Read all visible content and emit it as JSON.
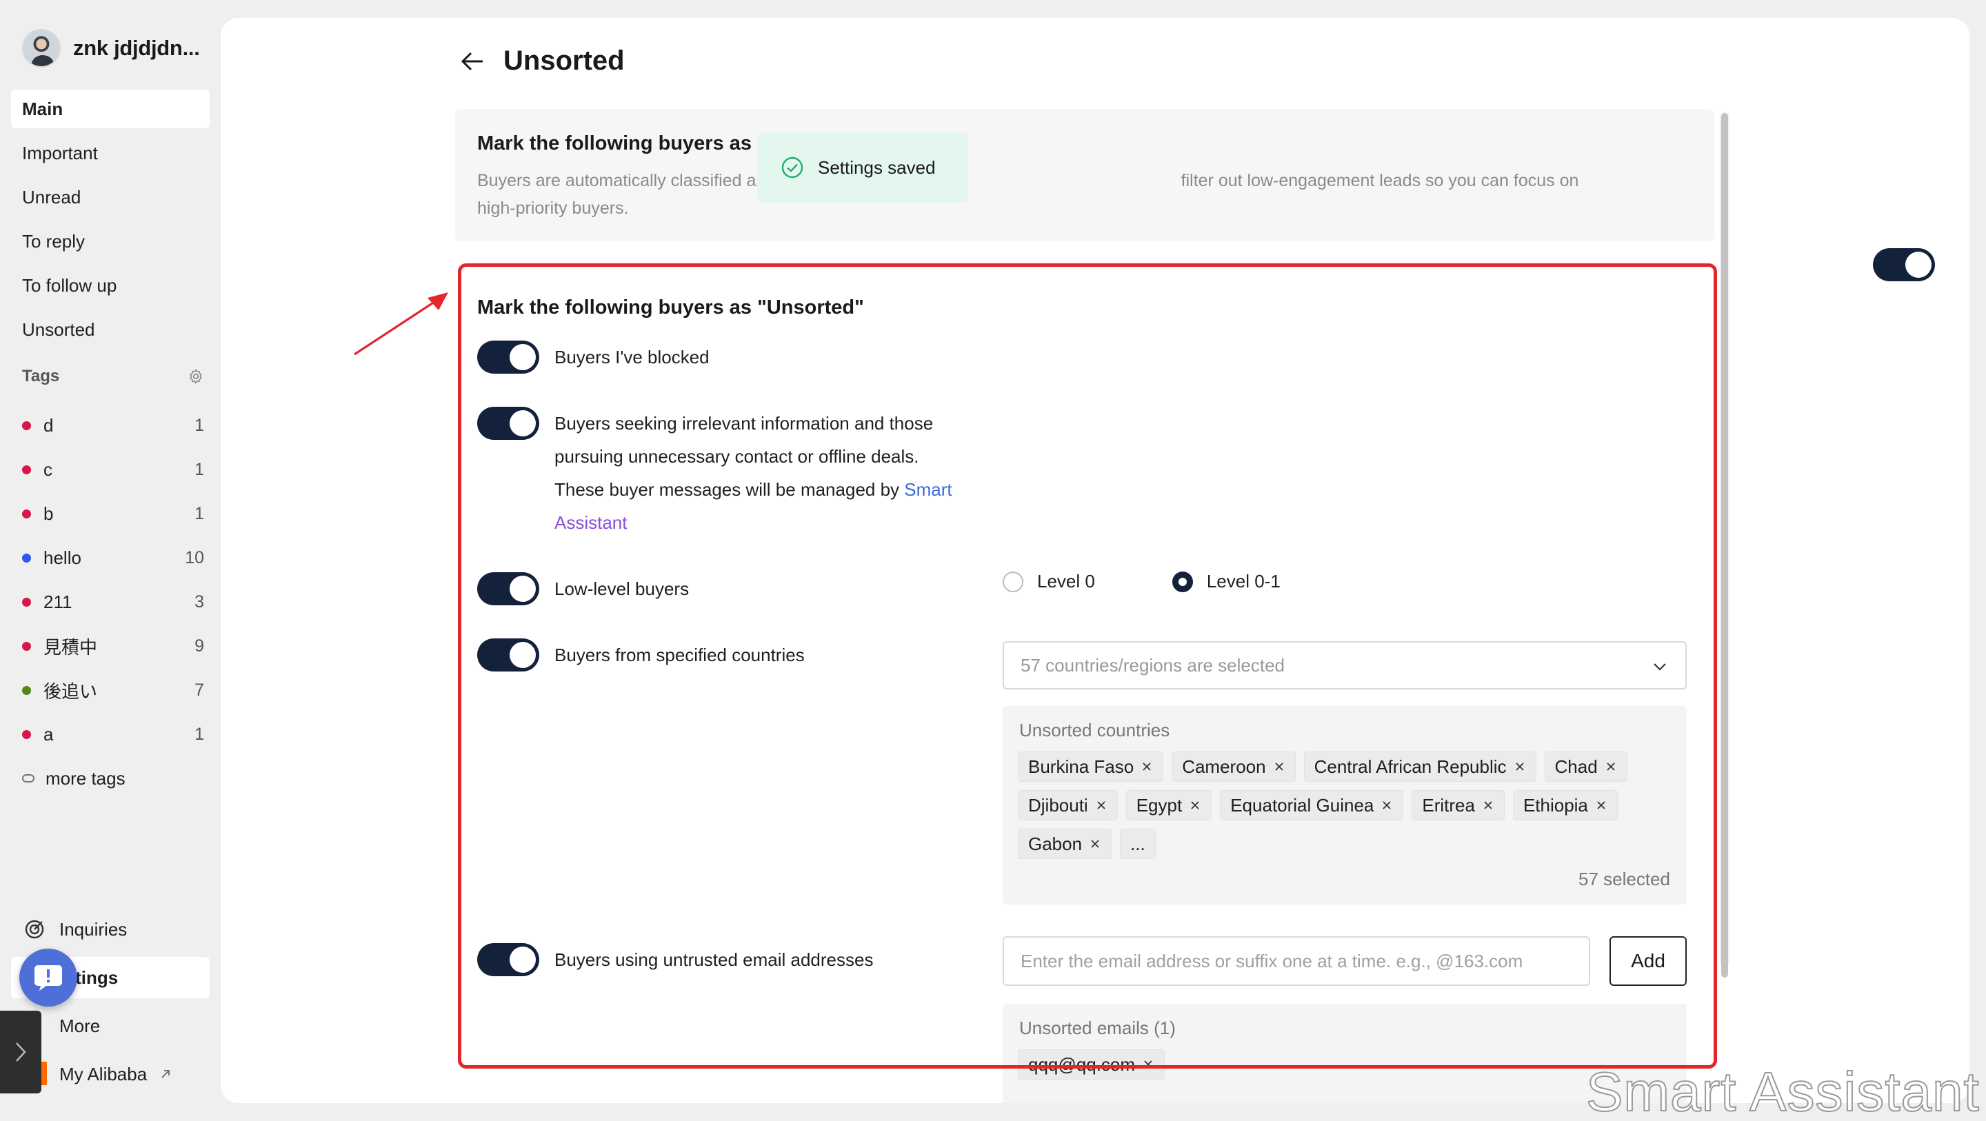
{
  "profile": {
    "name": "znk jdjdjdn..."
  },
  "nav": {
    "items": [
      {
        "label": "Main",
        "active": true
      },
      {
        "label": "Important"
      },
      {
        "label": "Unread"
      },
      {
        "label": "To reply"
      },
      {
        "label": "To follow up"
      },
      {
        "label": "Unsorted"
      }
    ]
  },
  "tags": {
    "header": "Tags",
    "items": [
      {
        "name": "d",
        "count": "1",
        "color": "#d6174a"
      },
      {
        "name": "c",
        "count": "1",
        "color": "#d6174a"
      },
      {
        "name": "b",
        "count": "1",
        "color": "#d6174a"
      },
      {
        "name": "hello",
        "count": "10",
        "color": "#2b59e8"
      },
      {
        "name": "211",
        "count": "3",
        "color": "#d6174a"
      },
      {
        "name": "見積中",
        "count": "9",
        "color": "#d6174a"
      },
      {
        "name": "後追い",
        "count": "7",
        "color": "#4f8a16"
      },
      {
        "name": "a",
        "count": "1",
        "color": "#d6174a"
      }
    ],
    "more_label": "more tags"
  },
  "bottom_nav": {
    "inquiries": "Inquiries",
    "settings": "Settings",
    "settings_visible": "ettings",
    "more": "More",
    "my_alibaba": "My Alibaba"
  },
  "page": {
    "title": "Unsorted"
  },
  "top_card": {
    "title": "Mark the following buyers as Unsorted",
    "desc_part1": "Buyers are automatically classified as Unsorted based on the f",
    "desc_part2": "filter out low-engagement leads so you can focus on",
    "desc_line2": "high-priority buyers.",
    "enabled": true
  },
  "toast": {
    "text": "Settings saved"
  },
  "rules_card": {
    "title": "Mark the following buyers as \"Unsorted\"",
    "blocked": "Buyers I've blocked",
    "irrelevant_1": "Buyers seeking irrelevant information and those",
    "irrelevant_2": "pursuing unnecessary contact or offline deals.",
    "irrelevant_3": "These buyer messages will be managed by ",
    "link_smart": "Smart",
    "link_assistant": "Assistant",
    "low_level": "Low-level buyers",
    "level_options": [
      {
        "label": "Level 0",
        "checked": false
      },
      {
        "label": "Level 0-1",
        "checked": true
      }
    ],
    "countries_rule": "Buyers from specified countries",
    "countries_select": "57 countries/regions are selected",
    "countries_box_label": "Unsorted countries",
    "countries": [
      "Burkina Faso",
      "Cameroon",
      "Central African Republic",
      "Chad",
      "Djibouti",
      "Egypt",
      "Equatorial Guinea",
      "Eritrea",
      "Ethiopia",
      "Gabon"
    ],
    "countries_more": "...",
    "countries_count": "57 selected",
    "email_rule": "Buyers using untrusted email addresses",
    "email_placeholder": "Enter the email address or suffix one at a time. e.g., @163.com",
    "add_label": "Add",
    "emails_box_label": "Unsorted emails (1)",
    "emails": [
      "qqq@qq.com"
    ]
  },
  "watermark": "Smart Assistant",
  "colors": {
    "toggle_on": "#13213b",
    "annotation_red": "#e3262a",
    "toast_bg": "#e3f7ee",
    "link": "#3a6bd8"
  }
}
